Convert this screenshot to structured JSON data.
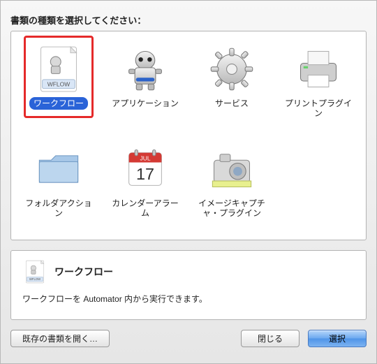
{
  "prompt": "書類の種類を選択してください：",
  "items": [
    {
      "label": "ワークフロー",
      "selected": true,
      "highlighted": true,
      "icon": "wflow-doc"
    },
    {
      "label": "アプリケーション",
      "selected": false,
      "highlighted": false,
      "icon": "automator-robot"
    },
    {
      "label": "サービス",
      "selected": false,
      "highlighted": false,
      "icon": "gear"
    },
    {
      "label": "プリントプラグイン",
      "selected": false,
      "highlighted": false,
      "icon": "printer"
    },
    {
      "label": "フォルダアクション",
      "selected": false,
      "highlighted": false,
      "icon": "folder"
    },
    {
      "label": "カレンダーアラーム",
      "selected": false,
      "highlighted": false,
      "icon": "calendar"
    },
    {
      "label": "イメージキャプチャ・プラグイン",
      "selected": false,
      "highlighted": false,
      "icon": "camera"
    }
  ],
  "description": {
    "title": "ワークフロー",
    "text": "ワークフローを Automator 内から実行できます。",
    "icon": "wflow-doc"
  },
  "buttons": {
    "open_existing": "既存の書類を開く…",
    "close": "閉じる",
    "choose": "選択"
  },
  "calendar": {
    "month": "JUL",
    "day": "17"
  },
  "wflow_tag": "WFLOW"
}
